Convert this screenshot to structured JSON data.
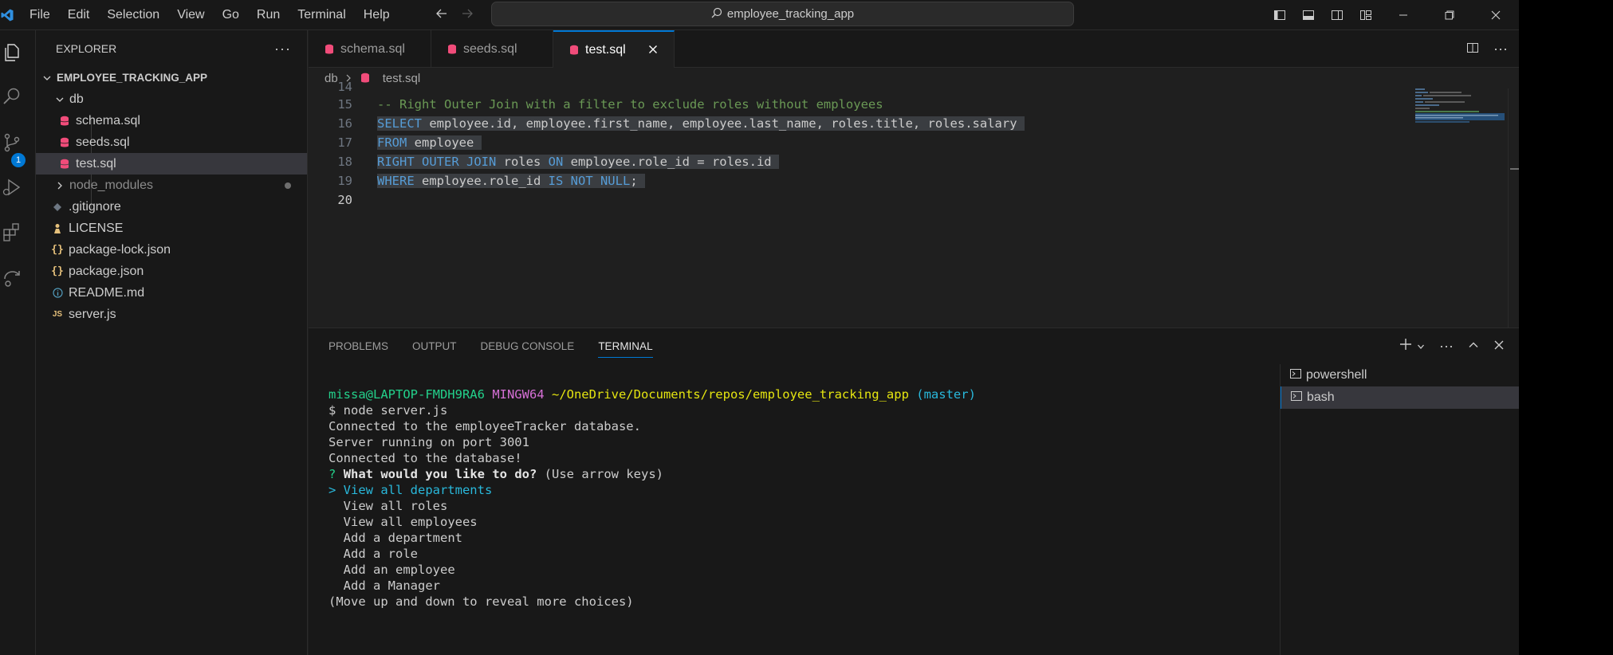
{
  "menu": [
    "File",
    "Edit",
    "Selection",
    "View",
    "Go",
    "Run",
    "Terminal",
    "Help"
  ],
  "search": {
    "text": "employee_tracking_app"
  },
  "sidebar": {
    "title": "EXPLORER",
    "project": "EMPLOYEE_TRACKING_APP",
    "items": [
      {
        "label": "db"
      },
      {
        "label": "schema.sql"
      },
      {
        "label": "seeds.sql"
      },
      {
        "label": "test.sql"
      },
      {
        "label": "node_modules"
      },
      {
        "label": ".gitignore"
      },
      {
        "label": "LICENSE"
      },
      {
        "label": "package-lock.json"
      },
      {
        "label": "package.json"
      },
      {
        "label": "README.md"
      },
      {
        "label": "server.js"
      }
    ]
  },
  "activity": {
    "scm_badge": "1"
  },
  "tabs": [
    {
      "label": "schema.sql"
    },
    {
      "label": "seeds.sql"
    },
    {
      "label": "test.sql"
    }
  ],
  "breadcrumb": {
    "folder": "db",
    "file": "test.sql"
  },
  "editor": {
    "line_numbers": [
      "14",
      "15",
      "16",
      "17",
      "18",
      "19",
      "20"
    ],
    "line15": "-- Right Outer Join with a filter to exclude roles without employees",
    "line16": {
      "kw": "SELECT",
      "rest": " employee.id, employee.first_name, employee.last_name, roles.title, roles.salary "
    },
    "line17": {
      "kw": "FROM",
      "rest": " employee "
    },
    "line18": {
      "kw1": "RIGHT OUTER JOIN",
      "mid": " roles ",
      "kw2": "ON",
      "rest": " employee.role_id = roles.id "
    },
    "line19": {
      "kw": "WHERE",
      "mid": " employee.role_id ",
      "kw2": "IS NOT NULL",
      "rest": "; "
    }
  },
  "panel": {
    "tabs": [
      "PROBLEMS",
      "OUTPUT",
      "DEBUG CONSOLE",
      "TERMINAL"
    ],
    "terminals": [
      "powershell",
      "bash"
    ]
  },
  "terminal": {
    "user": "missa@LAPTOP-FMDH9RA6",
    "env": "MINGW64",
    "path": "~/OneDrive/Documents/repos/employee_tracking_app",
    "branch": "(master)",
    "command": "$ node server.js",
    "out1": "Connected to the employeeTracker database.",
    "out2": "Server running on port 3001",
    "out3": "Connected to the database!",
    "q_mark": "?",
    "question": "What would you like to do?",
    "hint": "(Use arrow keys)",
    "selected": "> View all departments",
    "choices": [
      "View all roles",
      "View all employees",
      "Add a department",
      "Add a role",
      "Add an employee",
      "Add a Manager"
    ],
    "more": "(Move up and down to reveal more choices)"
  },
  "colors": {
    "accent": "#0078d4",
    "sql_icon": "#f14c7a",
    "json_icon": "#e5c07b",
    "keyword": "#569cd6",
    "comment": "#6a9955"
  }
}
